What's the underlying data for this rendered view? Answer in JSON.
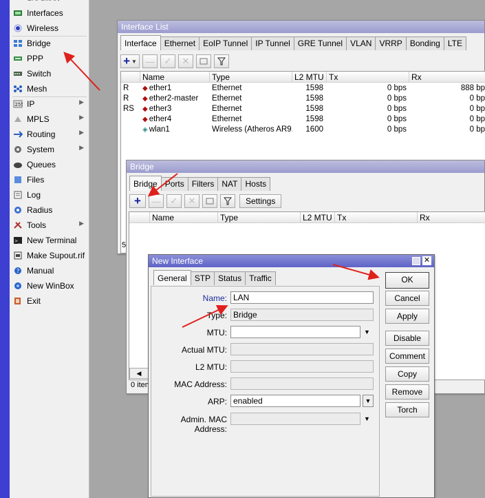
{
  "sidebar": {
    "items": [
      {
        "label": "Interfaces",
        "icon": "interfaces-icon"
      },
      {
        "label": "Wireless",
        "icon": "wireless-icon"
      },
      {
        "label": "Bridge",
        "icon": "bridge-icon"
      },
      {
        "label": "PPP",
        "icon": "ppp-icon"
      },
      {
        "label": "Switch",
        "icon": "switch-icon"
      },
      {
        "label": "Mesh",
        "icon": "mesh-icon"
      },
      {
        "label": "IP",
        "icon": "ip-icon"
      },
      {
        "label": "MPLS",
        "icon": "mpls-icon"
      },
      {
        "label": "Routing",
        "icon": "routing-icon"
      },
      {
        "label": "System",
        "icon": "system-icon"
      },
      {
        "label": "Queues",
        "icon": "queues-icon"
      },
      {
        "label": "Files",
        "icon": "files-icon"
      },
      {
        "label": "Log",
        "icon": "log-icon"
      },
      {
        "label": "Radius",
        "icon": "radius-icon"
      },
      {
        "label": "Tools",
        "icon": "tools-icon"
      },
      {
        "label": "New Terminal",
        "icon": "terminal-icon"
      },
      {
        "label": "Make Supout.rif",
        "icon": "supout-icon"
      },
      {
        "label": "Manual",
        "icon": "manual-icon"
      },
      {
        "label": "New WinBox",
        "icon": "winbox-icon"
      },
      {
        "label": "Exit",
        "icon": "exit-icon"
      }
    ]
  },
  "interface_list": {
    "title": "Interface List",
    "tabs": [
      "Interface",
      "Ethernet",
      "EoIP Tunnel",
      "IP Tunnel",
      "GRE Tunnel",
      "VLAN",
      "VRRP",
      "Bonding",
      "LTE"
    ],
    "columns": [
      "Name",
      "Type",
      "L2 MTU",
      "Tx",
      "Rx"
    ],
    "rows": [
      {
        "flag": "R",
        "name": "ether1",
        "type": "Ethernet",
        "l2mtu": "1598",
        "tx": "0 bps",
        "rx": "888 bp"
      },
      {
        "flag": "R",
        "name": "ether2-master",
        "type": "Ethernet",
        "l2mtu": "1598",
        "tx": "0 bps",
        "rx": "0 bp"
      },
      {
        "flag": "RS",
        "name": "ether3",
        "type": "Ethernet",
        "l2mtu": "1598",
        "tx": "0 bps",
        "rx": "0 bp"
      },
      {
        "flag": "",
        "name": "ether4",
        "type": "Ethernet",
        "l2mtu": "1598",
        "tx": "0 bps",
        "rx": "0 bp"
      },
      {
        "flag": "",
        "name": "wlan1",
        "type": "Wireless (Atheros AR9...",
        "l2mtu": "1600",
        "tx": "0 bps",
        "rx": "0 bp"
      }
    ],
    "status_fragment": "5"
  },
  "bridge": {
    "title": "Bridge",
    "tabs": [
      "Bridge",
      "Ports",
      "Filters",
      "NAT",
      "Hosts"
    ],
    "settings_label": "Settings",
    "columns": [
      "Name",
      "Type",
      "L2 MTU",
      "Tx",
      "Rx"
    ],
    "status_fragment": "0 item"
  },
  "new_interface": {
    "title": "New Interface",
    "tabs": [
      "General",
      "STP",
      "Status",
      "Traffic"
    ],
    "fields": {
      "name_label": "Name:",
      "name_value": "LAN",
      "type_label": "Type:",
      "type_value": "Bridge",
      "mtu_label": "MTU:",
      "actual_mtu_label": "Actual MTU:",
      "l2mtu_label": "L2 MTU:",
      "mac_label": "MAC Address:",
      "arp_label": "ARP:",
      "arp_value": "enabled",
      "admin_mac_label": "Admin. MAC Address:"
    },
    "buttons": [
      "OK",
      "Cancel",
      "Apply",
      "Disable",
      "Comment",
      "Copy",
      "Remove",
      "Torch"
    ]
  },
  "colors": {
    "accent_blue": "#3c3fd0",
    "annotation_red": "#e0201b"
  }
}
